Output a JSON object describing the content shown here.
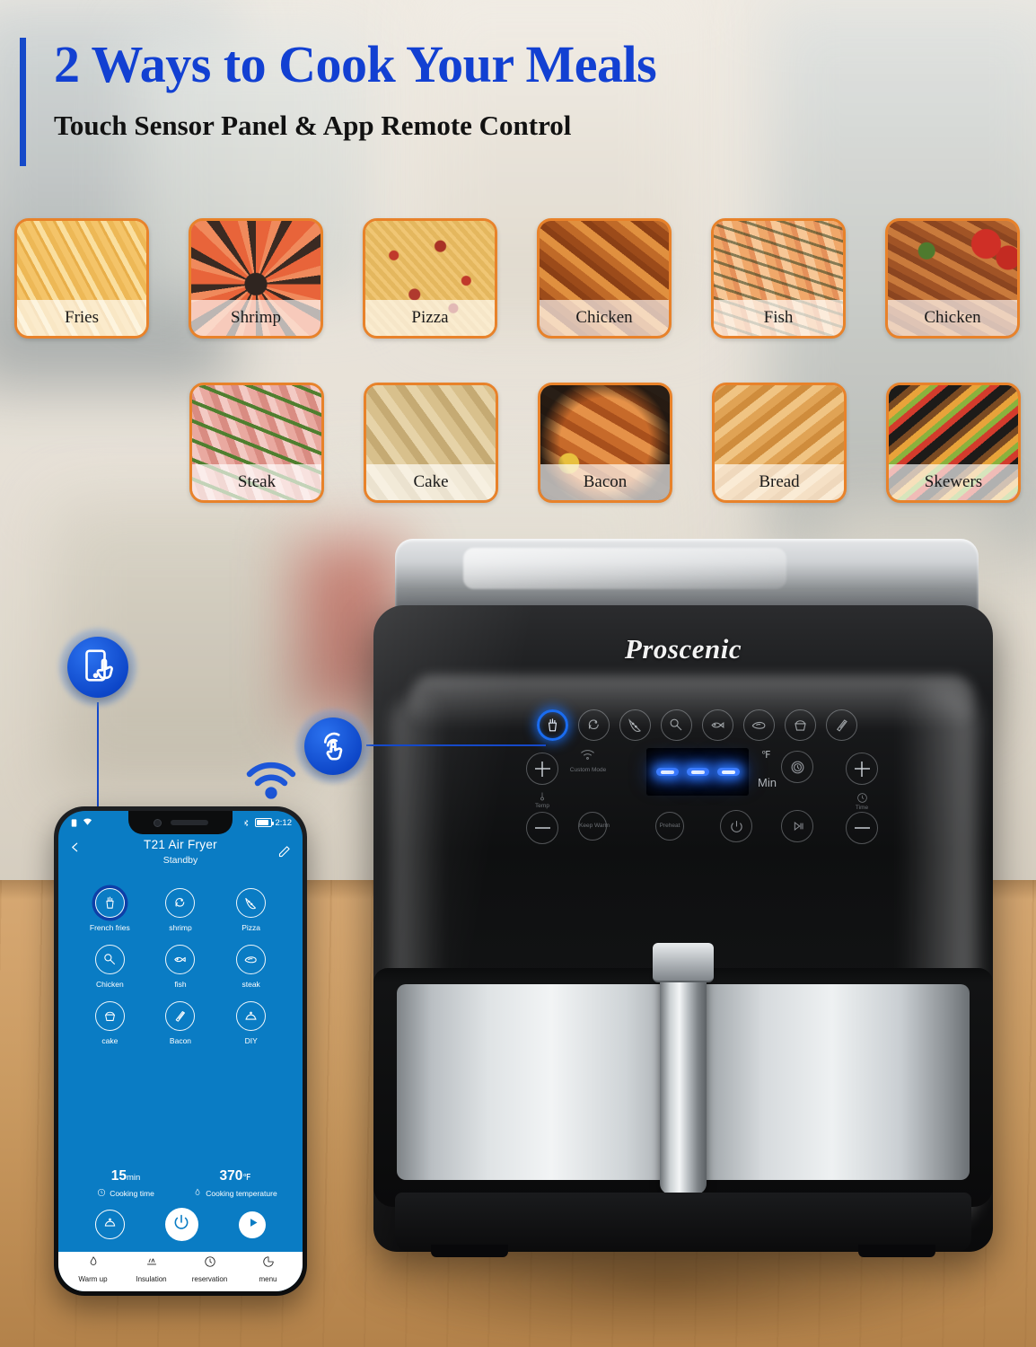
{
  "header": {
    "title": "2 Ways to Cook Your Meals",
    "subtitle": "Touch Sensor Panel & App Remote Control",
    "accent_color": "#1240d2"
  },
  "food_grid": {
    "border_color": "#e8822a",
    "row1": [
      {
        "label": "Fries",
        "art": "a-fries"
      },
      {
        "label": "Shrimp",
        "art": "a-shrimp"
      },
      {
        "label": "Pizza",
        "art": "a-pizza"
      },
      {
        "label": "Chicken",
        "art": "a-chickenwings"
      },
      {
        "label": "Fish",
        "art": "a-fish"
      },
      {
        "label": "Chicken",
        "art": "a-chickensteak"
      }
    ],
    "row2": [
      {
        "label": "Steak",
        "art": "a-steak"
      },
      {
        "label": "Cake",
        "art": "a-cake"
      },
      {
        "label": "Bacon",
        "art": "a-bacon"
      },
      {
        "label": "Bread",
        "art": "a-bread"
      },
      {
        "label": "Skewers",
        "art": "a-skewers"
      }
    ]
  },
  "callouts": {
    "app_badge_icon": "phone-touch-icon",
    "touch_badge_icon": "touch-gesture-icon",
    "wifi_icon": "wifi-icon",
    "badge_color": "#0d46c8"
  },
  "fryer": {
    "brand": "Proscenic",
    "panel": {
      "presets": [
        {
          "name": "fries-preset",
          "selected": true
        },
        {
          "name": "shrimp-preset",
          "selected": false
        },
        {
          "name": "pizza-preset",
          "selected": false
        },
        {
          "name": "chicken-preset",
          "selected": false
        },
        {
          "name": "fish-preset",
          "selected": false
        },
        {
          "name": "steak-preset",
          "selected": false
        },
        {
          "name": "cake-preset",
          "selected": false
        },
        {
          "name": "bacon-preset",
          "selected": false
        }
      ],
      "temp_label": "Temp",
      "time_label": "Time",
      "custom_mode_label": "Custom Mode",
      "keep_warm_label": "Keep Warm",
      "preheat_label": "Preheat",
      "unit_fahrenheit": "℉",
      "unit_minutes": "Min",
      "display_segments": 3,
      "display_color": "#3d7dff"
    }
  },
  "phone": {
    "status_bar": {
      "time": "2:12",
      "battery_icon": "battery-icon",
      "bluetooth_icon": "bluetooth-icon",
      "wifi_icon": "wifi-icon",
      "sim_icon": "sim-icon"
    },
    "app": {
      "back_icon": "back-arrow-icon",
      "edit_icon": "edit-pencil-icon",
      "title": "T21  Air Fryer",
      "status": "Standby",
      "functions": [
        {
          "label": "French fries",
          "icon": "fries-icon",
          "selected": true
        },
        {
          "label": "shrimp",
          "icon": "shrimp-icon",
          "selected": false
        },
        {
          "label": "Pizza",
          "icon": "pizza-icon",
          "selected": false
        },
        {
          "label": "Chicken",
          "icon": "chicken-icon",
          "selected": false
        },
        {
          "label": "fish",
          "icon": "fish-icon",
          "selected": false
        },
        {
          "label": "steak",
          "icon": "steak-icon",
          "selected": false
        },
        {
          "label": "cake",
          "icon": "cake-icon",
          "selected": false
        },
        {
          "label": "Bacon",
          "icon": "bacon-icon",
          "selected": false
        },
        {
          "label": "DIY",
          "icon": "diy-dome-icon",
          "selected": false
        }
      ],
      "cooking_time": {
        "value": "15",
        "unit": "min",
        "caption": "Cooking time",
        "icon": "clock-icon"
      },
      "cooking_temperature": {
        "value": "370",
        "unit": "℉",
        "caption": "Cooking temperature",
        "icon": "flame-icon"
      },
      "actions": [
        {
          "name": "diy-action",
          "icon": "dome-icon",
          "style": "outline"
        },
        {
          "name": "power-action",
          "icon": "power-icon",
          "style": "filled"
        },
        {
          "name": "start-action",
          "icon": "play-icon",
          "style": "filled"
        }
      ],
      "tabs": [
        {
          "label": "Warm up",
          "icon": "flame-icon"
        },
        {
          "label": "Insulation",
          "icon": "heat-waves-icon"
        },
        {
          "label": "reservation",
          "icon": "clock-icon"
        },
        {
          "label": "menu",
          "icon": "menu-pie-icon"
        }
      ]
    }
  }
}
